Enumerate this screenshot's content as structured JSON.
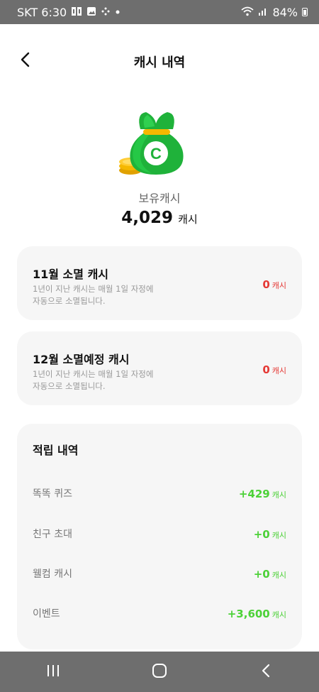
{
  "status": {
    "carrier_time": "SKT 6:30",
    "battery": "84%",
    "icons": [
      "notification-icon",
      "gallery-icon",
      "dots-icon",
      "dot-icon",
      "wifi-icon",
      "signal-icon",
      "battery-icon"
    ]
  },
  "header": {
    "title": "캐시 내역",
    "back_icon": "chevron-left-icon"
  },
  "balance": {
    "label": "보유캐시",
    "amount": "4,029",
    "unit": "캐시",
    "icon": "money-bag-icon",
    "bag_letter": "C"
  },
  "expired": {
    "title": "11월 소멸 캐시",
    "desc_line1": "1년이 지난 캐시는 매월 1일 자정에",
    "desc_line2": "자동으로 소멸됩니다.",
    "amount": "0",
    "unit": "캐시"
  },
  "expiring": {
    "title": "12월 소멸예정 캐시",
    "desc_line1": "1년이 지난 캐시는 매월 1일 자정에",
    "desc_line2": "자동으로 소멸됩니다.",
    "amount": "0",
    "unit": "캐시"
  },
  "history": {
    "title": "적립 내역",
    "items": [
      {
        "label": "똑똑 퀴즈",
        "amount": "+429",
        "unit": "캐시"
      },
      {
        "label": "친구 초대",
        "amount": "+0",
        "unit": "캐시"
      },
      {
        "label": "웰컴 캐시",
        "amount": "+0",
        "unit": "캐시"
      },
      {
        "label": "이벤트",
        "amount": "+3,600",
        "unit": "캐시"
      }
    ]
  },
  "colors": {
    "red": "#e53935",
    "green": "#4cd137",
    "card_bg": "#f6f6f6",
    "system_bar": "#6e6e6e"
  },
  "nav": {
    "icons": [
      "recent-apps-icon",
      "home-icon",
      "back-icon"
    ]
  }
}
